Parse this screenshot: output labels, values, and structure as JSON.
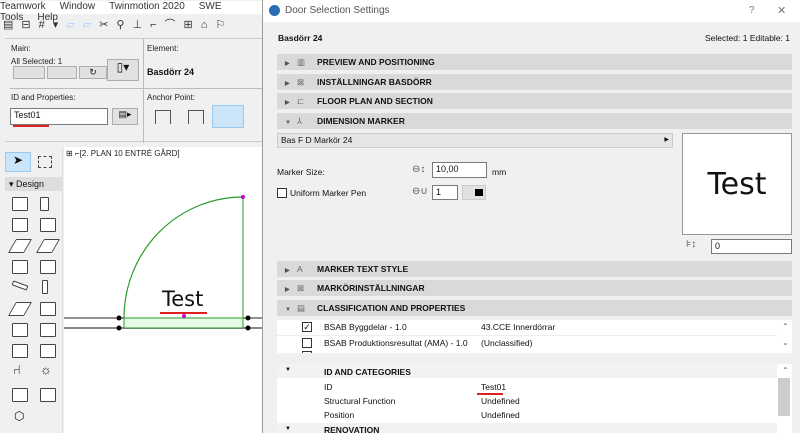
{
  "menu": [
    "Teamwork",
    "Window",
    "Twinmotion 2020",
    "SWE Tools",
    "Help"
  ],
  "info_box": {
    "main_label": "Main:",
    "all_selected": "All Selected: 1",
    "element_label": "Element:",
    "element_name": "Basdörr 24",
    "id_label": "ID and Properties:",
    "id_value": "Test01",
    "anchor_label": "Anchor Point:"
  },
  "toolbox": {
    "design_label": "Design"
  },
  "floor_plan": {
    "tab": "[2. PLAN 10 ENTRÉ GÅRD]",
    "marker_text": "Test"
  },
  "dialog": {
    "title": "Door Selection Settings",
    "help": "?",
    "close": "✕",
    "element_name": "Basdörr 24",
    "selected": "Selected: 1 Editable: 1",
    "sections": [
      "PREVIEW AND POSITIONING",
      "INSTÄLLNINGAR BASDÖRR",
      "FLOOR PLAN AND SECTION",
      "DIMENSION MARKER",
      "MARKER TEXT STYLE",
      "MARKÖRINSTÄLLNINGAR",
      "CLASSIFICATION AND PROPERTIES"
    ],
    "marker_dropdown": "Bas F D Markör 24",
    "marker_size_label": "Marker Size:",
    "marker_size": "10,00",
    "marker_size_unit": "mm",
    "uniform_pen_label": "Uniform Marker Pen",
    "pen_value": "1",
    "preview_text": "Test",
    "offset_value": "0",
    "classifications": [
      {
        "checked": true,
        "system": "BSAB Byggdelar - 1.0",
        "value": "43.CCE Innerdörrar"
      },
      {
        "checked": false,
        "system": "BSAB Produktionsresultat (AMA) - 1.0",
        "value": "(Unclassified)"
      }
    ],
    "id_categories": {
      "header": "ID AND CATEGORIES",
      "rows": [
        {
          "name": "ID",
          "value": "Test01"
        },
        {
          "name": "Structural Function",
          "value": "Undefined"
        },
        {
          "name": "Position",
          "value": "Undefined"
        }
      ],
      "next_header": "RENOVATION"
    }
  },
  "colors": {
    "accent": "#cce4f7",
    "door_green": "#2a9a2a",
    "underline": "#e02020"
  }
}
